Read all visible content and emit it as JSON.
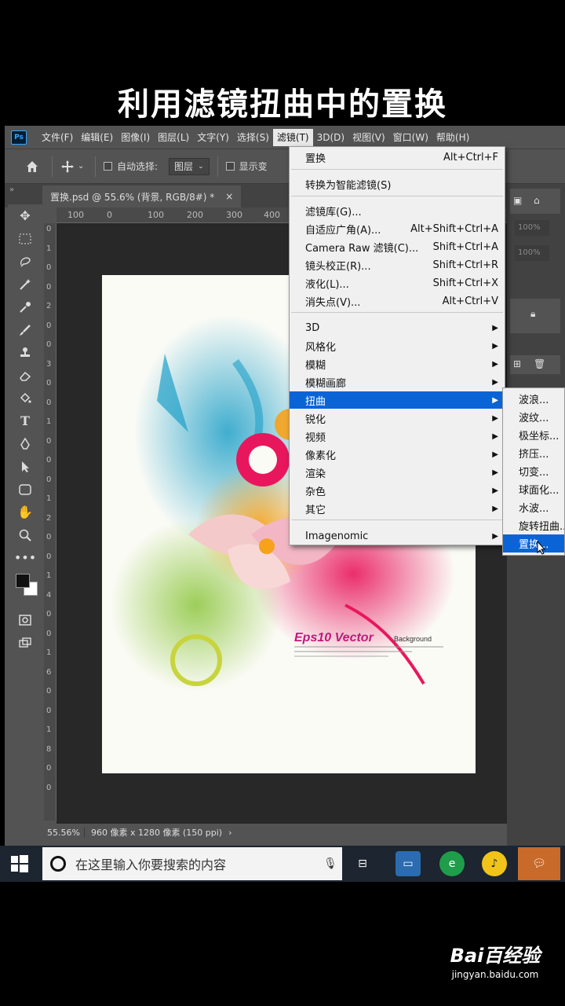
{
  "video_title": "利用滤镜扭曲中的置换",
  "menubar": {
    "logo": "Ps",
    "items": [
      "文件(F)",
      "编辑(E)",
      "图像(I)",
      "图层(L)",
      "文字(Y)",
      "选择(S)",
      "滤镜(T)",
      "3D(D)",
      "视图(V)",
      "窗口(W)",
      "帮助(H)"
    ],
    "active_index": 6
  },
  "options_bar": {
    "auto_select_label": "自动选择:",
    "auto_select_value": "图层",
    "show_transform_label": "显示变"
  },
  "document": {
    "tab_title": "置换.psd @ 55.6% (背景, RGB/8#) *",
    "close_icon": "×",
    "ruler_h": [
      "100",
      "0",
      "100",
      "200",
      "300",
      "400"
    ],
    "ruler_v": [
      "0",
      "1",
      "0",
      "0",
      "2",
      "0",
      "0",
      "3",
      "0",
      "0",
      "1",
      "0",
      "0",
      "0",
      "1",
      "2",
      "0",
      "0",
      "1",
      "4",
      "0",
      "0",
      "1",
      "6",
      "0",
      "0",
      "1",
      "8",
      "0",
      "0"
    ],
    "art_text": "Eps10 Vector",
    "art_sub": "Background"
  },
  "status": {
    "zoom": "55.56%",
    "info": "960 像素 x 1280 像素 (150 ppi)"
  },
  "right_panel": {
    "opacity": "100%",
    "fill": "100%"
  },
  "filter_menu": {
    "items": [
      {
        "label": "置换",
        "shortcut": "Alt+Ctrl+F"
      },
      {
        "label": "转换为智能滤镜(S)",
        "shortcut": ""
      },
      {
        "label": "滤镜库(G)...",
        "shortcut": ""
      },
      {
        "label": "自适应广角(A)...",
        "shortcut": "Alt+Shift+Ctrl+A"
      },
      {
        "label": "Camera Raw 滤镜(C)...",
        "shortcut": "Shift+Ctrl+A"
      },
      {
        "label": "镜头校正(R)...",
        "shortcut": "Shift+Ctrl+R"
      },
      {
        "label": "液化(L)...",
        "shortcut": "Shift+Ctrl+X"
      },
      {
        "label": "消失点(V)...",
        "shortcut": "Alt+Ctrl+V"
      },
      {
        "label": "3D",
        "shortcut": ""
      },
      {
        "label": "风格化",
        "shortcut": ""
      },
      {
        "label": "模糊",
        "shortcut": ""
      },
      {
        "label": "模糊画廊",
        "shortcut": ""
      },
      {
        "label": "扭曲",
        "shortcut": ""
      },
      {
        "label": "锐化",
        "shortcut": ""
      },
      {
        "label": "视频",
        "shortcut": ""
      },
      {
        "label": "像素化",
        "shortcut": ""
      },
      {
        "label": "渲染",
        "shortcut": ""
      },
      {
        "label": "杂色",
        "shortcut": ""
      },
      {
        "label": "其它",
        "shortcut": ""
      },
      {
        "label": "Imagenomic",
        "shortcut": ""
      }
    ],
    "highlight_label": "扭曲"
  },
  "distort_submenu": {
    "items": [
      "波浪...",
      "波纹...",
      "极坐标...",
      "挤压...",
      "切变...",
      "球面化...",
      "水波...",
      "旋转扭曲...",
      "置换..."
    ],
    "highlight_label": "置换..."
  },
  "taskbar": {
    "search_placeholder": "在这里输入你要搜索的内容"
  },
  "watermark": {
    "brand": "Bai百经验",
    "url": "jingyan.baidu.com"
  }
}
